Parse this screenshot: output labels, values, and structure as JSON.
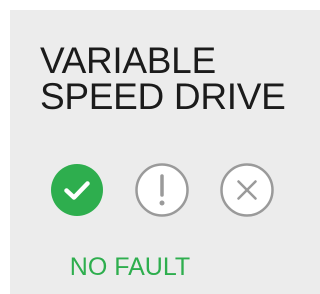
{
  "widget": {
    "title_line1": "VARIABLE",
    "title_line2": "SPEED DRIVE",
    "status_text": "NO FAULT"
  },
  "indicators": [
    {
      "icon": "check-circle-icon",
      "state": "active",
      "color": "#2eae4e"
    },
    {
      "icon": "exclamation-circle-icon",
      "state": "inactive",
      "color": "#9a9a9a"
    },
    {
      "icon": "x-circle-icon",
      "state": "inactive",
      "color": "#9a9a9a"
    }
  ],
  "colors": {
    "ok_green": "#2eae4e",
    "inactive_gray": "#9a9a9a",
    "title_text": "#1b1b1b",
    "panel_background": "#ececec"
  }
}
